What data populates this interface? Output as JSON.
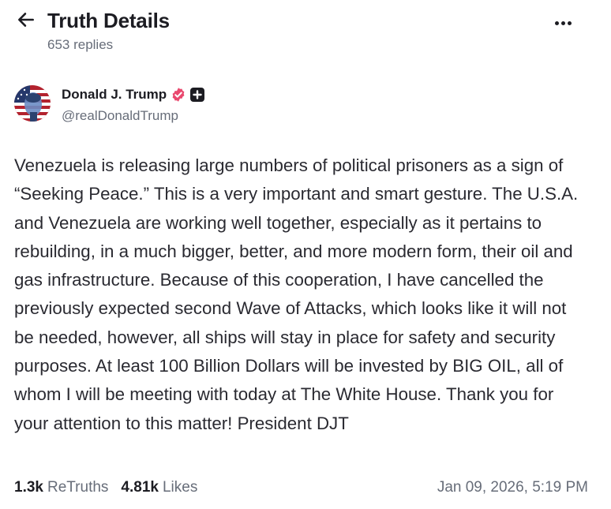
{
  "header": {
    "title": "Truth Details",
    "replies": "653 replies",
    "back_icon": "arrow-left-icon",
    "more_icon": "more-horizontal-icon"
  },
  "post": {
    "author": {
      "name": "Donald J. Trump",
      "handle": "@realDonaldTrump",
      "verified_icon": "verified-badge-icon",
      "verified_color": "#e9486e",
      "plus_icon": "plus-badge-icon"
    },
    "text": "Venezuela is releasing large numbers of political prisoners as a sign of “Seeking Peace.” This is a very important and smart gesture. The U.S.A. and Venezuela are working well together, especially as it pertains to rebuilding, in a much bigger, better, and more modern form, their oil and gas infrastructure. Because of this cooperation, I have cancelled the previously expected second Wave of Attacks, which looks like it will not be needed, however, all ships will stay in place for safety and security purposes. At least 100 Billion Dollars will be invested by BIG OIL, all of whom I will be meeting with today at The White House. Thank you for your attention to this matter! President DJT",
    "stats": {
      "retruths_count": "1.3k",
      "retruths_label": "ReTruths",
      "likes_count": "4.81k",
      "likes_label": "Likes"
    },
    "timestamp": "Jan 09, 2026, 5:19 PM"
  },
  "colors": {
    "text_primary": "#1c1c22",
    "text_secondary": "#676d79",
    "body_text": "#2a2a31",
    "verified": "#e9486e"
  }
}
